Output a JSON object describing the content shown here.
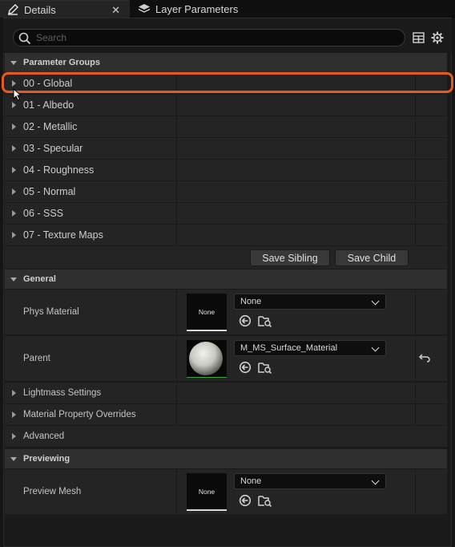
{
  "tabs": {
    "details": "Details",
    "layer_parameters": "Layer Parameters",
    "close": "✕"
  },
  "search": {
    "placeholder": "Search",
    "value": ""
  },
  "sections": {
    "parameter_groups": "Parameter Groups",
    "general": "General",
    "previewing": "Previewing"
  },
  "parameter_groups": [
    "00 - Global",
    "01 - Albedo",
    "02 - Metallic",
    "03 - Specular",
    "04 - Roughness",
    "05 - Normal",
    "06 - SSS",
    "07 - Texture Maps"
  ],
  "buttons": {
    "save_sibling": "Save Sibling",
    "save_child": "Save Child"
  },
  "general": {
    "phys_material": {
      "label": "Phys Material",
      "thumb": "None",
      "value": "None"
    },
    "parent": {
      "label": "Parent",
      "value": "M_MS_Surface_Material"
    },
    "collapsed": [
      "Lightmass Settings",
      "Material Property Overrides",
      "Advanced"
    ]
  },
  "previewing": {
    "preview_mesh": {
      "label": "Preview Mesh",
      "thumb": "None",
      "value": "None"
    }
  },
  "colors": {
    "highlight": "#e55a23",
    "panel": "#242424",
    "header": "#2f2f2f"
  }
}
